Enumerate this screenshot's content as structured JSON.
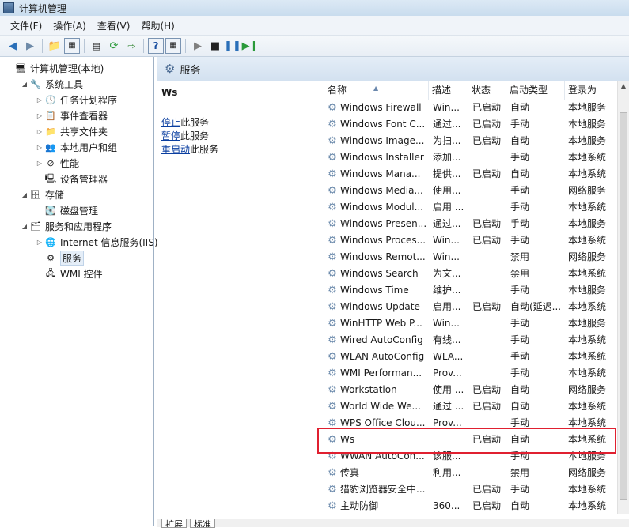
{
  "window": {
    "title": "计算机管理"
  },
  "menu": [
    {
      "label": "文件(F)"
    },
    {
      "label": "操作(A)"
    },
    {
      "label": "查看(V)"
    },
    {
      "label": "帮助(H)"
    }
  ],
  "tree": [
    {
      "label": "计算机管理(本地)",
      "indent": 0,
      "arrow": "",
      "icon": "computer-icon",
      "glyph": "🖥"
    },
    {
      "label": "系统工具",
      "indent": 1,
      "arrow": "◢",
      "icon": "tools-icon",
      "glyph": "🔧"
    },
    {
      "label": "任务计划程序",
      "indent": 2,
      "arrow": "▷",
      "icon": "clock-icon",
      "glyph": "🕓"
    },
    {
      "label": "事件查看器",
      "indent": 2,
      "arrow": "▷",
      "icon": "event-viewer-icon",
      "glyph": "📋"
    },
    {
      "label": "共享文件夹",
      "indent": 2,
      "arrow": "▷",
      "icon": "shared-folder-icon",
      "glyph": "📁"
    },
    {
      "label": "本地用户和组",
      "indent": 2,
      "arrow": "▷",
      "icon": "users-icon",
      "glyph": "👥"
    },
    {
      "label": "性能",
      "indent": 2,
      "arrow": "▷",
      "icon": "performance-icon",
      "glyph": "⊘"
    },
    {
      "label": "设备管理器",
      "indent": 2,
      "arrow": "",
      "icon": "device-manager-icon",
      "glyph": "🖳"
    },
    {
      "label": "存储",
      "indent": 1,
      "arrow": "◢",
      "icon": "storage-icon",
      "glyph": "🗄"
    },
    {
      "label": "磁盘管理",
      "indent": 2,
      "arrow": "",
      "icon": "disk-icon",
      "glyph": "💽"
    },
    {
      "label": "服务和应用程序",
      "indent": 1,
      "arrow": "◢",
      "icon": "services-apps-icon",
      "glyph": "🗂"
    },
    {
      "label": "Internet 信息服务(IIS)管",
      "indent": 2,
      "arrow": "▷",
      "icon": "iis-icon",
      "glyph": "🌐"
    },
    {
      "label": "服务",
      "indent": 2,
      "arrow": "",
      "icon": "gear-icon",
      "glyph": "⚙",
      "selected": true
    },
    {
      "label": "WMI 控件",
      "indent": 2,
      "arrow": "",
      "icon": "wmi-icon",
      "glyph": "🖧"
    }
  ],
  "services_panel": {
    "header": "服务",
    "selected_service": "Ws",
    "actions": [
      {
        "link": "停止",
        "rest": "此服务"
      },
      {
        "link": "暂停",
        "rest": "此服务"
      },
      {
        "link": "重启动",
        "rest": "此服务"
      }
    ]
  },
  "columns": {
    "name": "名称",
    "desc": "描述",
    "state": "状态",
    "startup": "启动类型",
    "logon": "登录为"
  },
  "rows": [
    {
      "name": "Windows Firewall",
      "desc": "Win...",
      "state": "已启动",
      "startup": "自动",
      "logon": "本地服务"
    },
    {
      "name": "Windows Font C...",
      "desc": "通过...",
      "state": "已启动",
      "startup": "手动",
      "logon": "本地服务"
    },
    {
      "name": "Windows Image...",
      "desc": "为扫...",
      "state": "已启动",
      "startup": "自动",
      "logon": "本地服务"
    },
    {
      "name": "Windows Installer",
      "desc": "添加...",
      "state": "",
      "startup": "手动",
      "logon": "本地系统"
    },
    {
      "name": "Windows Mana...",
      "desc": "提供...",
      "state": "已启动",
      "startup": "自动",
      "logon": "本地系统"
    },
    {
      "name": "Windows Media...",
      "desc": "使用...",
      "state": "",
      "startup": "手动",
      "logon": "网络服务"
    },
    {
      "name": "Windows Modul...",
      "desc": "启用 ...",
      "state": "",
      "startup": "手动",
      "logon": "本地系统"
    },
    {
      "name": "Windows Presen...",
      "desc": "通过...",
      "state": "已启动",
      "startup": "手动",
      "logon": "本地服务"
    },
    {
      "name": "Windows Proces...",
      "desc": "Win...",
      "state": "已启动",
      "startup": "手动",
      "logon": "本地系统"
    },
    {
      "name": "Windows Remot...",
      "desc": "Win...",
      "state": "",
      "startup": "禁用",
      "logon": "网络服务"
    },
    {
      "name": "Windows Search",
      "desc": "为文...",
      "state": "",
      "startup": "禁用",
      "logon": "本地系统"
    },
    {
      "name": "Windows Time",
      "desc": "维护...",
      "state": "",
      "startup": "手动",
      "logon": "本地服务"
    },
    {
      "name": "Windows Update",
      "desc": "启用...",
      "state": "已启动",
      "startup": "自动(延迟...",
      "logon": "本地系统"
    },
    {
      "name": "WinHTTP Web P...",
      "desc": "Win...",
      "state": "",
      "startup": "手动",
      "logon": "本地服务"
    },
    {
      "name": "Wired AutoConfig",
      "desc": "有线...",
      "state": "",
      "startup": "手动",
      "logon": "本地系统"
    },
    {
      "name": "WLAN AutoConfig",
      "desc": "WLA...",
      "state": "",
      "startup": "手动",
      "logon": "本地系统"
    },
    {
      "name": "WMI Performan...",
      "desc": "Prov...",
      "state": "",
      "startup": "手动",
      "logon": "本地系统"
    },
    {
      "name": "Workstation",
      "desc": "使用 ...",
      "state": "已启动",
      "startup": "自动",
      "logon": "网络服务"
    },
    {
      "name": "World Wide We...",
      "desc": "通过 ...",
      "state": "已启动",
      "startup": "自动",
      "logon": "本地系统"
    },
    {
      "name": "WPS Office Clou...",
      "desc": "Prov...",
      "state": "",
      "startup": "手动",
      "logon": "本地系统"
    },
    {
      "name": "Ws",
      "desc": "",
      "state": "已启动",
      "startup": "自动",
      "logon": "本地系统"
    },
    {
      "name": "WWAN AutoCon...",
      "desc": "该服...",
      "state": "",
      "startup": "手动",
      "logon": "本地服务"
    },
    {
      "name": "传真",
      "desc": "利用...",
      "state": "",
      "startup": "禁用",
      "logon": "网络服务"
    },
    {
      "name": "猎豹浏览器安全中...",
      "desc": "",
      "state": "已启动",
      "startup": "手动",
      "logon": "本地系统"
    },
    {
      "name": "主动防御",
      "desc": "360...",
      "state": "已启动",
      "startup": "自动",
      "logon": "本地系统"
    }
  ],
  "tabs": [
    {
      "label": "扩展"
    },
    {
      "label": "标准"
    }
  ],
  "colors": {
    "highlight": "#e02030",
    "link": "#0a3ea0"
  }
}
